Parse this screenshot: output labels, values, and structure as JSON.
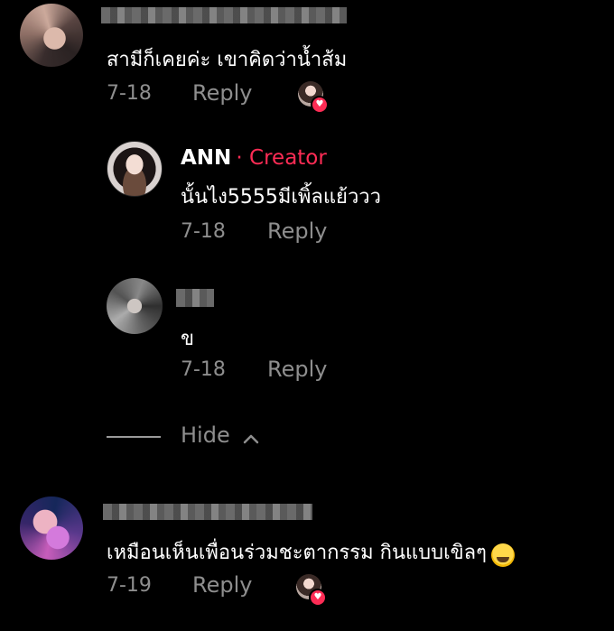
{
  "comments": [
    {
      "text": "สามีก็เคยค่ะ เขาคิดว่าน้ำส้ม",
      "date": "7-18",
      "reply_label": "Reply"
    },
    {
      "author": "ANN",
      "creator_tag": "· Creator",
      "text": "นั้นไง5555มีเพิ้ลแย้ววว",
      "date": "7-18",
      "reply_label": "Reply"
    },
    {
      "text": "ข",
      "date": "7-18",
      "reply_label": "Reply"
    },
    {
      "text": "เหมือนเห็นเพื่อนร่วมชะตากรรม กินแบบเขิลๆ",
      "date": "7-19",
      "reply_label": "Reply"
    }
  ],
  "hide_label": "Hide",
  "icons": {
    "heart": "heart-icon",
    "chevron": "chevron-up-icon",
    "emoji": "grinning-sweat-emoji"
  },
  "colors": {
    "creator": "#fe2c55",
    "meta": "#8e8e8e",
    "background": "#000000"
  }
}
